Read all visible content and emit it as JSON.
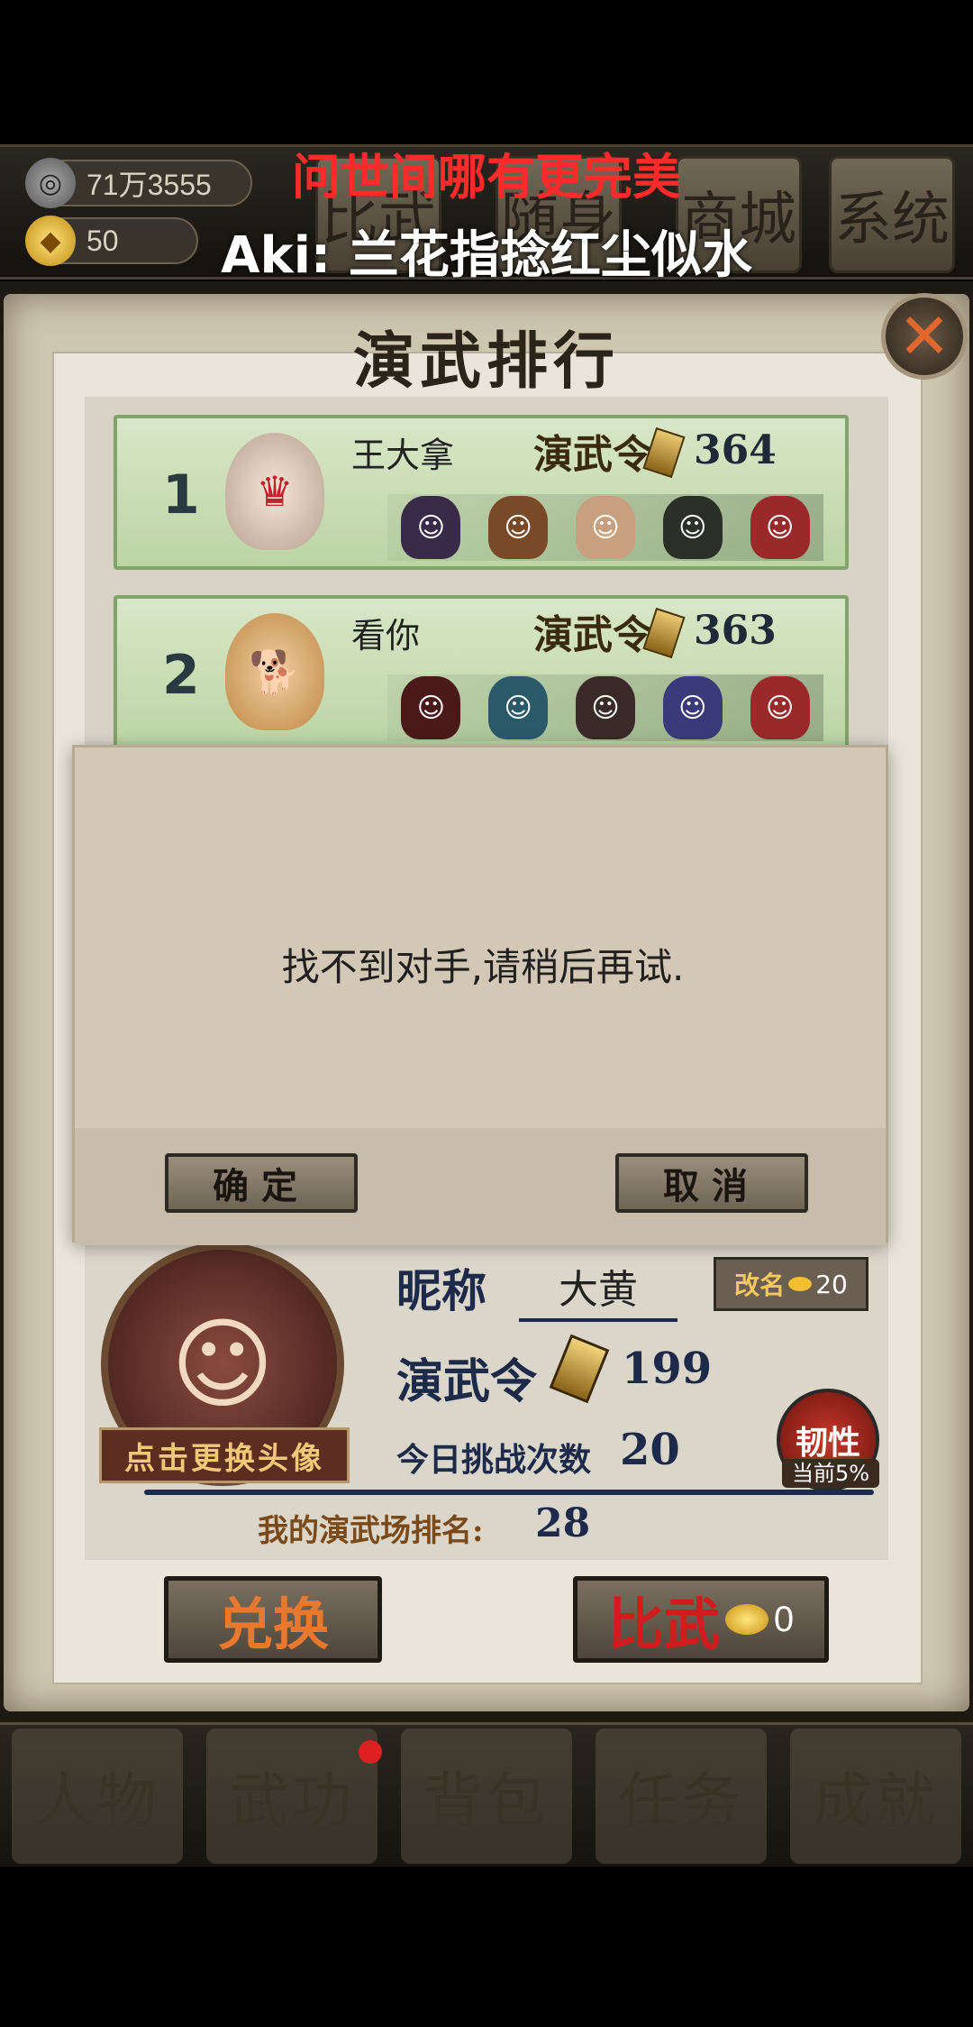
{
  "status": {
    "coins": "71万3555",
    "gold": "50"
  },
  "top_menu": [
    "比武",
    "随身",
    "商城",
    "系统"
  ],
  "lyrics": {
    "line1": "问世间哪有更完美",
    "line2": "Aki: 兰花指捻红尘似水"
  },
  "panel": {
    "title": "演武排行",
    "close_icon": "close-icon"
  },
  "rankings": [
    {
      "rank": "1",
      "name": "王大拿",
      "token_label": "演武令",
      "score": "364"
    },
    {
      "rank": "2",
      "name": "看你",
      "token_label": "演武令",
      "score": "363"
    }
  ],
  "dialog": {
    "message": "找不到对手,请稍后再试.",
    "confirm": "确定",
    "cancel": "取消"
  },
  "profile": {
    "nickname_label": "昵称",
    "nickname": "大黄",
    "rename_label": "改名",
    "rename_cost": "20",
    "change_avatar": "点击更换头像",
    "token_label": "演武令",
    "token_count": "199",
    "challenges_label": "今日挑战次数",
    "challenges": "20",
    "toughness_label": "韧性",
    "toughness_pct": "当前5%",
    "my_rank_label": "我的演武场排名:",
    "my_rank": "28"
  },
  "actions": {
    "exchange": "兑换",
    "battle": "比武",
    "battle_cost": "0"
  },
  "bottom_nav": [
    "人物",
    "武功",
    "背包",
    "任务",
    "成就"
  ],
  "colors": {
    "card_green": "#c9ddb4",
    "dialog_bg": "#d3c7b6",
    "lyric_red": "#ff2a2a"
  }
}
